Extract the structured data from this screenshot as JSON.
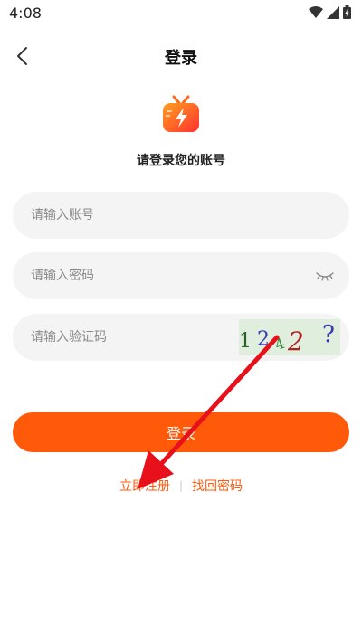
{
  "status_bar": {
    "time": "4:08"
  },
  "header": {
    "title": "登录"
  },
  "subtitle": "请登录您的账号",
  "form": {
    "account_placeholder": "请输入账号",
    "password_placeholder": "请输入密码",
    "captcha_placeholder": "请输入验证码",
    "captcha_chars": [
      "1",
      "2",
      "4",
      "2",
      "?"
    ]
  },
  "login_button": {
    "label": "登录"
  },
  "links": {
    "register": "立即注册",
    "separator": "|",
    "forgot_password": "找回密码"
  },
  "colors": {
    "accent": "#ff5a0a",
    "field_bg": "#f4f4f4",
    "annotation_arrow": "#e8101a"
  }
}
